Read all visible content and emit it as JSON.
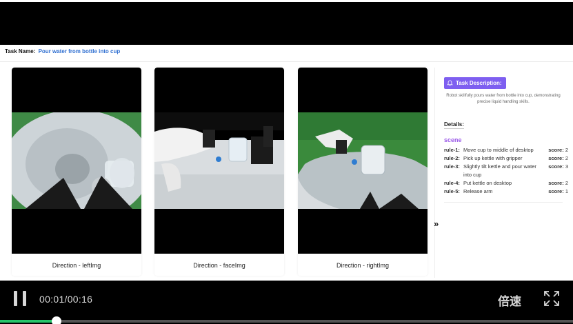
{
  "task": {
    "label": "Task Name:",
    "name": "Pour water from bottle into cup"
  },
  "views": [
    {
      "caption": "Direction - leftImg"
    },
    {
      "caption": "Direction - faceImg"
    },
    {
      "caption": "Direction - rightImg"
    }
  ],
  "side_panel": {
    "task_description_label": "Task Description:",
    "description": "Robot skillfully pours water from bottle into cup, demonstrating precise liquid handling skills.",
    "details_label": "Details:",
    "scene_label": "scene",
    "rules": [
      {
        "id": "rule-1:",
        "text": "Move cup to middle of desktop",
        "score_label": "score:",
        "score": "2"
      },
      {
        "id": "rule-2:",
        "text": "Pick up kettle with gripper",
        "score_label": "score:",
        "score": "2"
      },
      {
        "id": "rule-3:",
        "text": "Slightly tilt kettle and pour water into cup",
        "score_label": "score:",
        "score": "3"
      },
      {
        "id": "rule-4:",
        "text": "Put kettle on desktop",
        "score_label": "score:",
        "score": "2"
      },
      {
        "id": "rule-5:",
        "text": "Release arm",
        "score_label": "score:",
        "score": "1"
      }
    ],
    "expand_glyph": "»"
  },
  "player": {
    "time": "00:01/00:16",
    "speed_label": "倍速",
    "progress_fraction": 0.0625,
    "accent_color": "#27c46b"
  },
  "icons": {
    "pause": "pause-icon",
    "fullscreen": "fullscreen-icon",
    "task": "bell-icon"
  }
}
